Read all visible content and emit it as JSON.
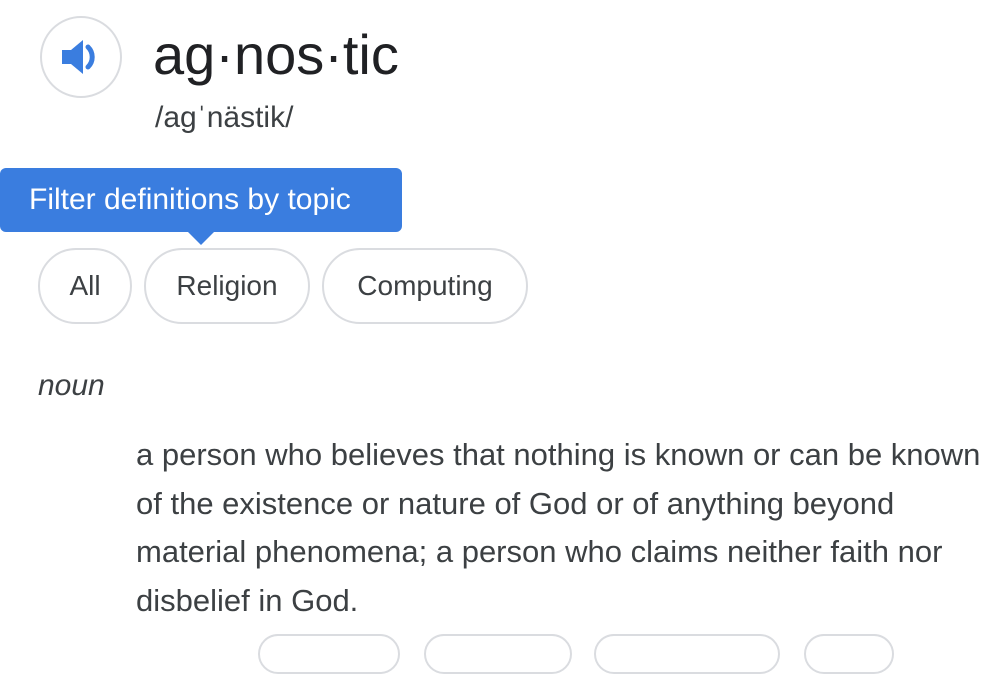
{
  "entry": {
    "headword": "ag·nos·tic",
    "phonetic": "/agˈnästik/",
    "audio_icon": "speaker-icon"
  },
  "topic_filter": {
    "tooltip": "Filter definitions by topic",
    "chips": [
      {
        "label": "All"
      },
      {
        "label": "Religion"
      },
      {
        "label": "Computing"
      }
    ]
  },
  "sense": {
    "part_of_speech": "noun",
    "definition": "a person who believes that nothing is known or can be known of the existence or nature of God or of anything beyond material phenomena; a person who claims neither faith nor disbelief in God."
  },
  "colors": {
    "accent": "#3a7ddf",
    "chip_border": "#dadce0",
    "text": "#202124"
  }
}
